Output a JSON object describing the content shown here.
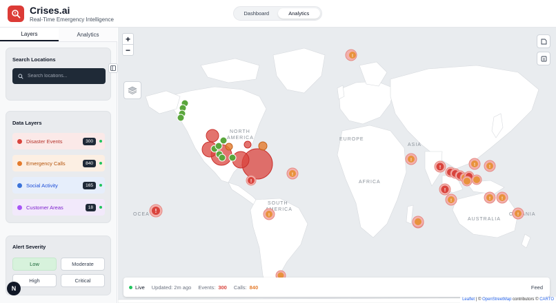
{
  "app": {
    "title": "Crises.ai",
    "subtitle": "Real-Time Emergency Intelligence",
    "brand_color": "#dc3b36"
  },
  "topnav": {
    "tabs": [
      {
        "label": "Dashboard",
        "active": false
      },
      {
        "label": "Analytics",
        "active": true
      }
    ]
  },
  "sidebar": {
    "tabs": [
      {
        "label": "Layers",
        "active": true
      },
      {
        "label": "Analytics",
        "active": false
      }
    ],
    "search": {
      "title": "Search Locations",
      "placeholder": "Search locations..."
    },
    "data_layers": {
      "title": "Data Layers",
      "items": [
        {
          "label": "Disaster Events",
          "count": "300",
          "color": "#d9443d",
          "bg": "#fbe9e8",
          "text_color": "#b4322b"
        },
        {
          "label": "Emergency Calls",
          "count": "840",
          "color": "#e47b2c",
          "bg": "#fcefe3",
          "text_color": "#b45309"
        },
        {
          "label": "Social Activity",
          "count": "165",
          "color": "#3b73d9",
          "bg": "#e6eefb",
          "text_color": "#1d4ed8"
        },
        {
          "label": "Customer Areas",
          "count": "18",
          "color": "#a855f7",
          "bg": "#f2e9fb",
          "text_color": "#7e22ce"
        }
      ]
    },
    "alert_severity": {
      "title": "Alert Severity",
      "options": [
        {
          "label": "Low",
          "active": true
        },
        {
          "label": "Moderate",
          "active": false
        },
        {
          "label": "High",
          "active": false
        },
        {
          "label": "Critical",
          "active": false
        }
      ]
    },
    "badge": "N"
  },
  "map": {
    "labels": {
      "north_america": "NORTH",
      "north_america2": "AMERICA",
      "europe": "EUROPE",
      "asia": "ASIA",
      "africa": "AFRICA",
      "south_america": "SOUTH",
      "south_america2": "AMERICA",
      "australia": "AUSTRALIA",
      "ocean_left": "OCEA",
      "ocean_right": "OCEANIA"
    },
    "zoom_in": "+",
    "zoom_out": "−",
    "status_bar": {
      "live": "Live",
      "updated": "Updated: 2m ago",
      "events_label": "Events:",
      "events_value": "300",
      "calls_label": "Calls:",
      "calls_value": "840",
      "feed": "Feed"
    },
    "attribution": {
      "leaflet": "Leaflet",
      "sep": " | © ",
      "osm": "OpenStreetMap",
      "contrib": " contributors © ",
      "carto": "CARTO"
    }
  }
}
